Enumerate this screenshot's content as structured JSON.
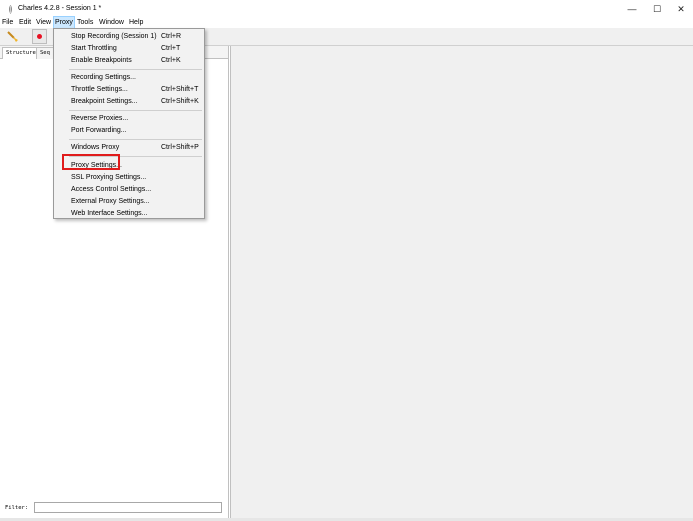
{
  "window": {
    "title": "Charles 4.2.8 - Session 1 *",
    "minimize_glyph": "—",
    "maximize_glyph": "☐",
    "close_glyph": "✕"
  },
  "menubar": {
    "items": [
      {
        "label": "File"
      },
      {
        "label": "Edit"
      },
      {
        "label": "View"
      },
      {
        "label": "Proxy",
        "active": true
      },
      {
        "label": "Tools"
      },
      {
        "label": "Window"
      },
      {
        "label": "Help"
      }
    ]
  },
  "toolbar": {
    "icons": [
      "broom-icon",
      "record-icon"
    ],
    "record_color": "#e81123"
  },
  "left_panel": {
    "tabs": [
      {
        "label": "Structure"
      },
      {
        "label": "Seq"
      }
    ],
    "filter_label": "Filter:",
    "filter_value": ""
  },
  "proxy_menu": {
    "groups": [
      [
        {
          "label": "Stop Recording (Session 1)",
          "shortcut": "Ctrl+R"
        },
        {
          "label": "Start Throttling",
          "shortcut": "Ctrl+T"
        },
        {
          "label": "Enable Breakpoints",
          "shortcut": "Ctrl+K"
        }
      ],
      [
        {
          "label": "Recording Settings...",
          "shortcut": ""
        },
        {
          "label": "Throttle Settings...",
          "shortcut": "Ctrl+Shift+T"
        },
        {
          "label": "Breakpoint Settings...",
          "shortcut": "Ctrl+Shift+K"
        }
      ],
      [
        {
          "label": "Reverse Proxies...",
          "shortcut": ""
        },
        {
          "label": "Port Forwarding...",
          "shortcut": ""
        }
      ],
      [
        {
          "label": "Windows Proxy",
          "shortcut": "Ctrl+Shift+P"
        }
      ],
      [
        {
          "label": "Proxy Settings...",
          "shortcut": "",
          "highlighted": true
        },
        {
          "label": "SSL Proxying Settings...",
          "shortcut": ""
        },
        {
          "label": "Access Control Settings...",
          "shortcut": ""
        },
        {
          "label": "External Proxy Settings...",
          "shortcut": ""
        },
        {
          "label": "Web Interface Settings...",
          "shortcut": ""
        }
      ]
    ],
    "highlight_color": "#e01b1b"
  }
}
